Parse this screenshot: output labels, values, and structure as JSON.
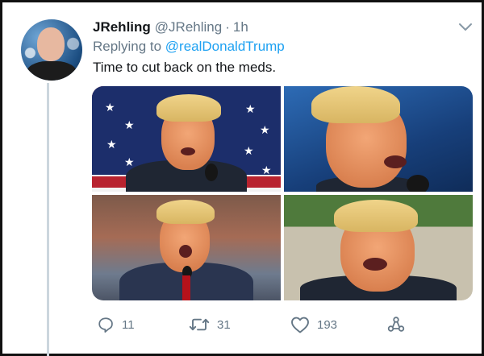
{
  "tweet": {
    "display_name": "JRehling",
    "handle": "@JRehling",
    "separator": "·",
    "time": "1h",
    "replying_prefix": "Replying to",
    "replying_to": "@realDonaldTrump",
    "text": "Time to cut back on the meds."
  },
  "media": {
    "count": 4,
    "items": [
      {
        "position": "top-left",
        "subject": "man speaking at microphone in front of flag"
      },
      {
        "position": "top-right",
        "subject": "man with surprised expression, blue background"
      },
      {
        "position": "bottom-left",
        "subject": "man shouting at microphone in front of crowd"
      },
      {
        "position": "bottom-right",
        "subject": "man grimacing in office"
      }
    ]
  },
  "actions": {
    "reply_count": "11",
    "retweet_count": "31",
    "like_count": "193"
  },
  "icons": {
    "reply": "reply-icon",
    "retweet": "retweet-icon",
    "like": "heart-icon",
    "share": "share-icon",
    "menu": "chevron-down-icon"
  },
  "colors": {
    "text": "#14171a",
    "muted": "#657786",
    "link": "#1da1f2",
    "thread_line": "#ccd6dd"
  }
}
